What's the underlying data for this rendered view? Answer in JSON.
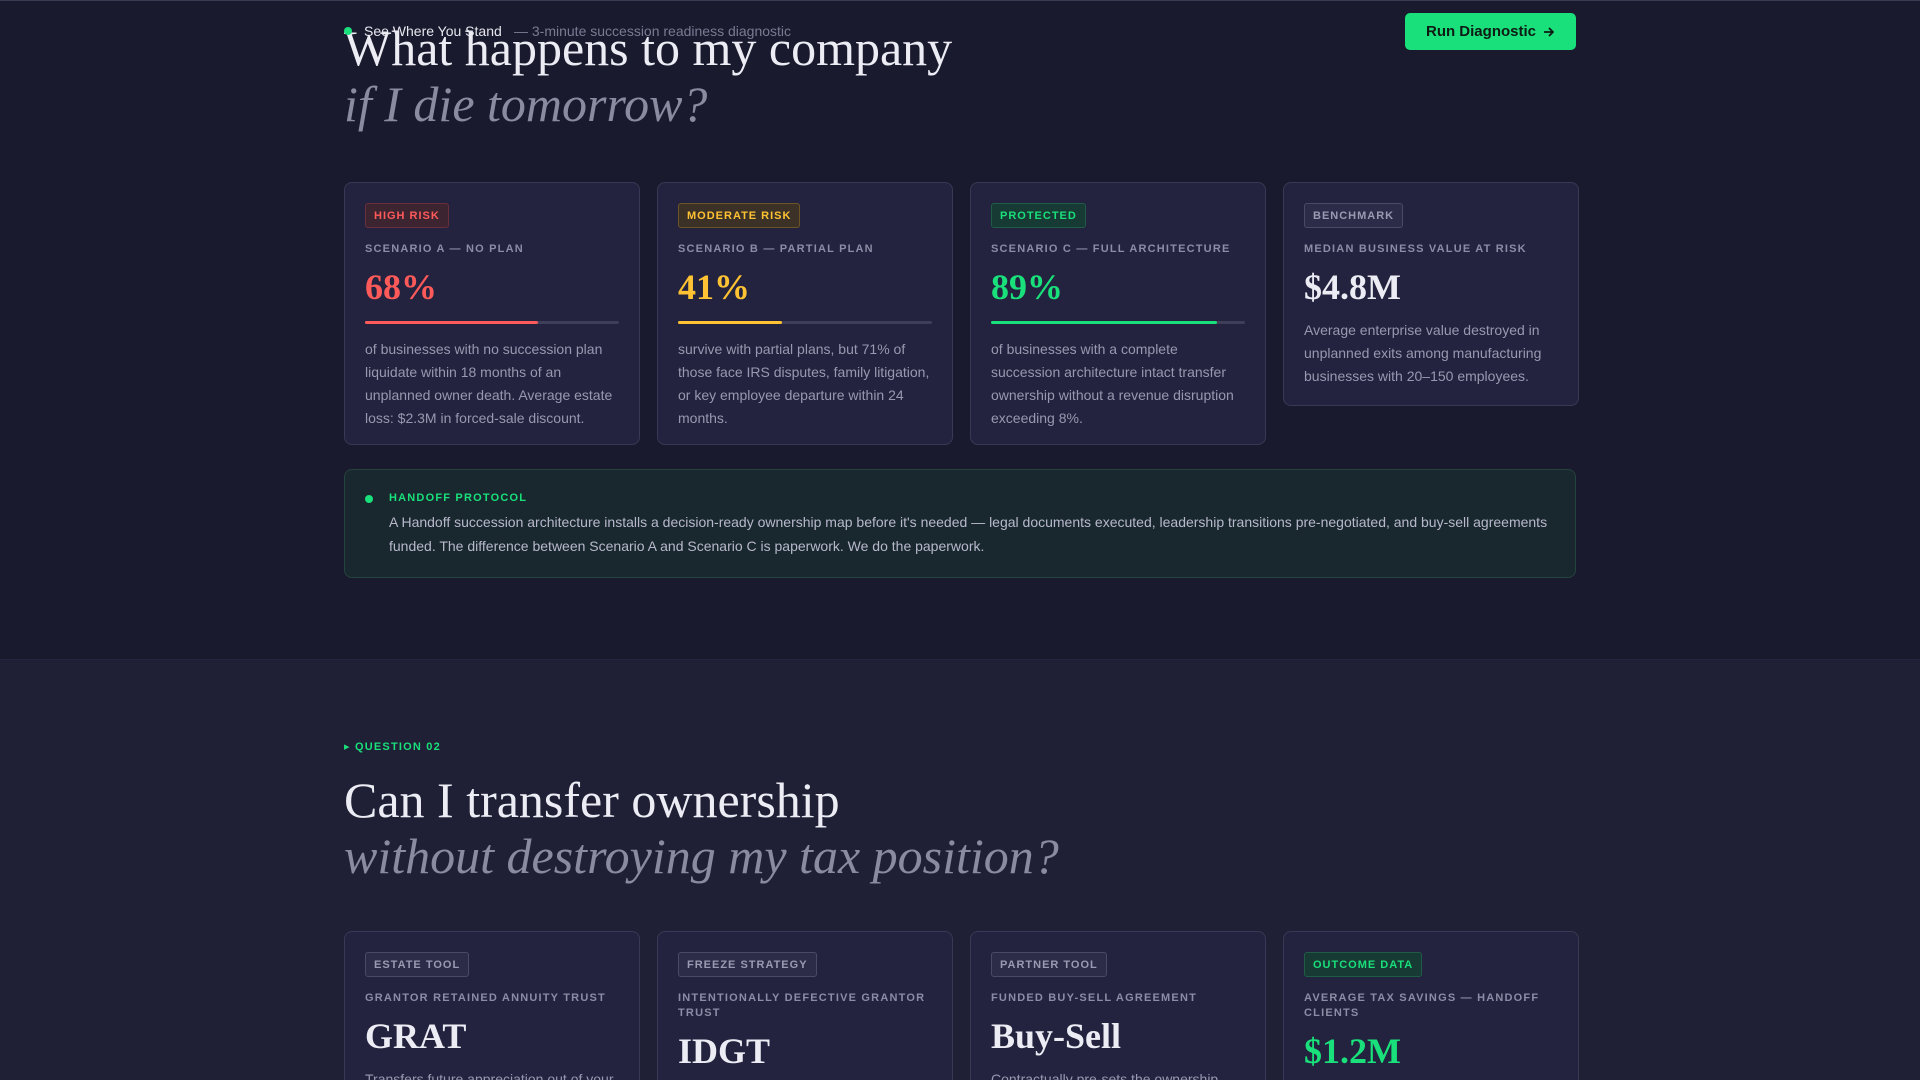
{
  "nav": {
    "title": "See Where You Stand",
    "subtitle": "— 3-minute succession readiness diagnostic",
    "cta_label": "Run Diagnostic",
    "cta_icon": "arrow-right-icon",
    "accent": "#19e07a"
  },
  "question1": {
    "title_line1": "What happens to my company",
    "title_line2": "if I die tomorrow?",
    "cards": [
      {
        "badge": "HIGH RISK",
        "label": "SCENARIO A — NO PLAN",
        "value": "68%",
        "progress": 0.68,
        "color": "#ff5a5a",
        "desc": "of businesses with no succession plan liquidate within 18 months of an unplanned owner death. Average estate loss: $2.3M in forced-sale discount."
      },
      {
        "badge": "MODERATE RISK",
        "label": "SCENARIO B — PARTIAL PLAN",
        "value": "41%",
        "progress": 0.41,
        "color": "#ffc233",
        "desc": "survive with partial plans, but 71% of those face IRS disputes, family litigation, or key employee departure within 24 months."
      },
      {
        "badge": "PROTECTED",
        "label": "SCENARIO C — FULL ARCHITECTURE",
        "value": "89%",
        "progress": 0.89,
        "color": "#19e07a",
        "desc": "of businesses with a complete succession architecture intact transfer ownership without a revenue disruption exceeding 8%."
      },
      {
        "badge": "BENCHMARK",
        "label": "MEDIAN BUSINESS VALUE AT RISK",
        "value": "$4.8M",
        "desc": "Average enterprise value destroyed in unplanned exits among manufacturing businesses with 20–150 employees."
      }
    ],
    "protocol": {
      "label": "HANDOFF PROTOCOL",
      "text": "A Handoff succession architecture installs a decision-ready ownership map before it's needed — legal documents executed, leadership transitions pre-negotiated, and buy-sell agreements funded. The difference between Scenario A and Scenario C is paperwork. We do the paperwork."
    }
  },
  "question2": {
    "eyebrow": "▸ QUESTION 02",
    "title_line1": "Can I transfer ownership",
    "title_line2": "without destroying my tax position?",
    "cards": [
      {
        "badge": "ESTATE TOOL",
        "label": "GRANTOR RETAINED ANNUITY TRUST",
        "value": "GRAT",
        "desc": "Transfers future appreciation out of your"
      },
      {
        "badge": "FREEZE STRATEGY",
        "label": "INTENTIONALLY DEFECTIVE GRANTOR TRUST",
        "value": "IDGT",
        "desc": ""
      },
      {
        "badge": "PARTNER TOOL",
        "label": "FUNDED BUY-SELL AGREEMENT",
        "value": "Buy-Sell",
        "desc": "Contractually pre-sets the ownership"
      },
      {
        "badge": "OUTCOME DATA",
        "label": "AVERAGE TAX SAVINGS — HANDOFF CLIENTS",
        "value": "$1.2M",
        "desc": ""
      }
    ]
  }
}
